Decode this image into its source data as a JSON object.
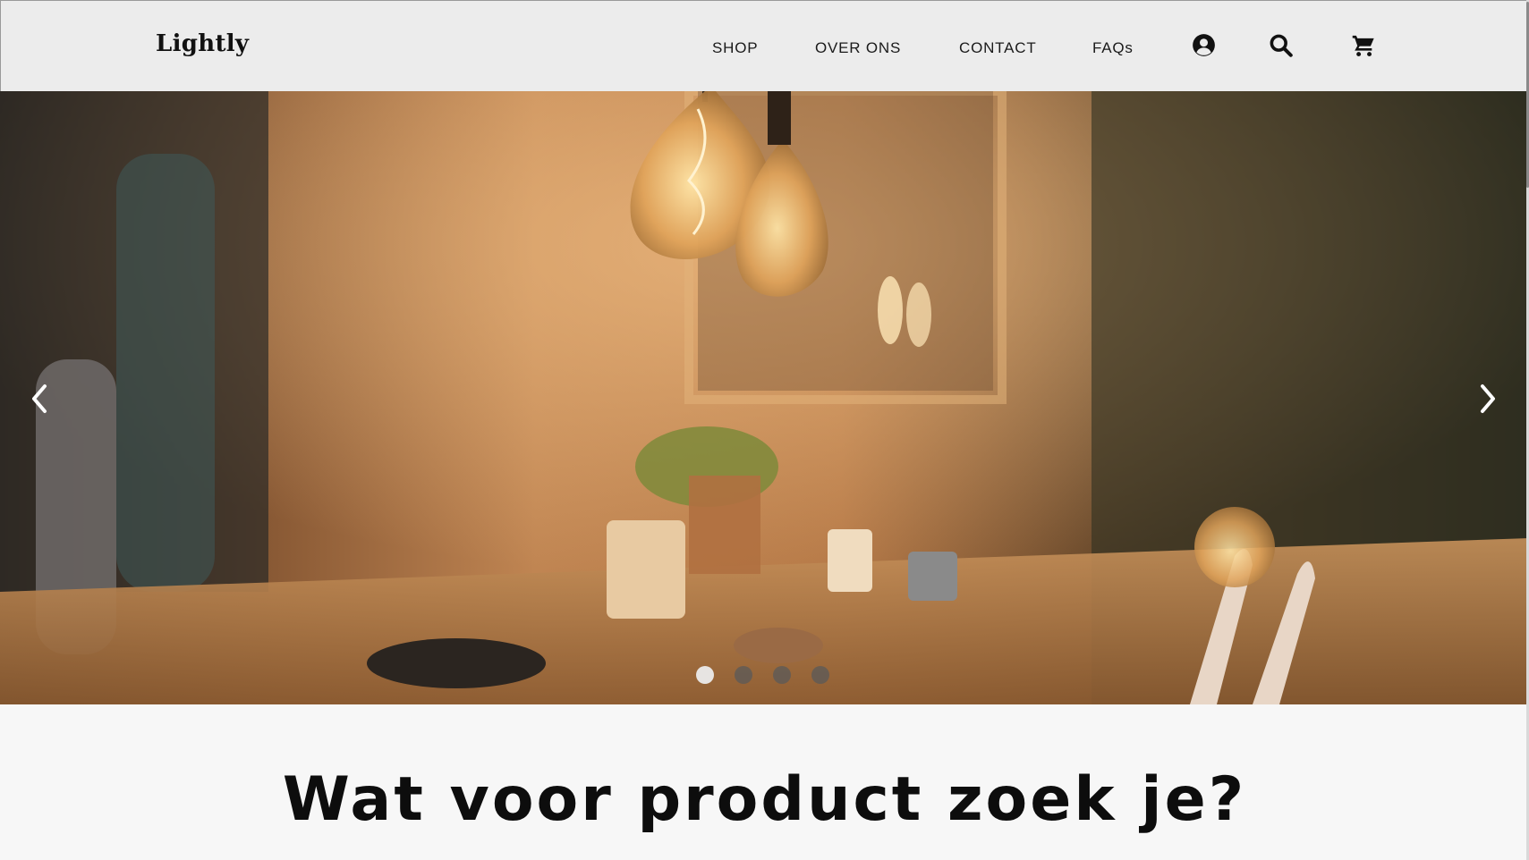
{
  "header": {
    "logo": "Lightly",
    "nav": [
      {
        "label": "SHOP"
      },
      {
        "label": "OVER ONS"
      },
      {
        "label": "CONTACT"
      },
      {
        "label": "FAQs"
      }
    ],
    "icons": [
      "account-icon",
      "search-icon",
      "cart-icon"
    ]
  },
  "hero": {
    "slide_count": 4,
    "active_slide": 1,
    "prev_icon": "chevron-left-icon",
    "next_icon": "chevron-right-icon"
  },
  "main": {
    "heading": "Wat voor product zoek je?"
  },
  "colors": {
    "header_bg": "#ececec",
    "page_bg": "#f7f7f7",
    "text": "#111111",
    "dot_active": "#ebebeb",
    "dot_inactive": "#5a5a5a"
  }
}
